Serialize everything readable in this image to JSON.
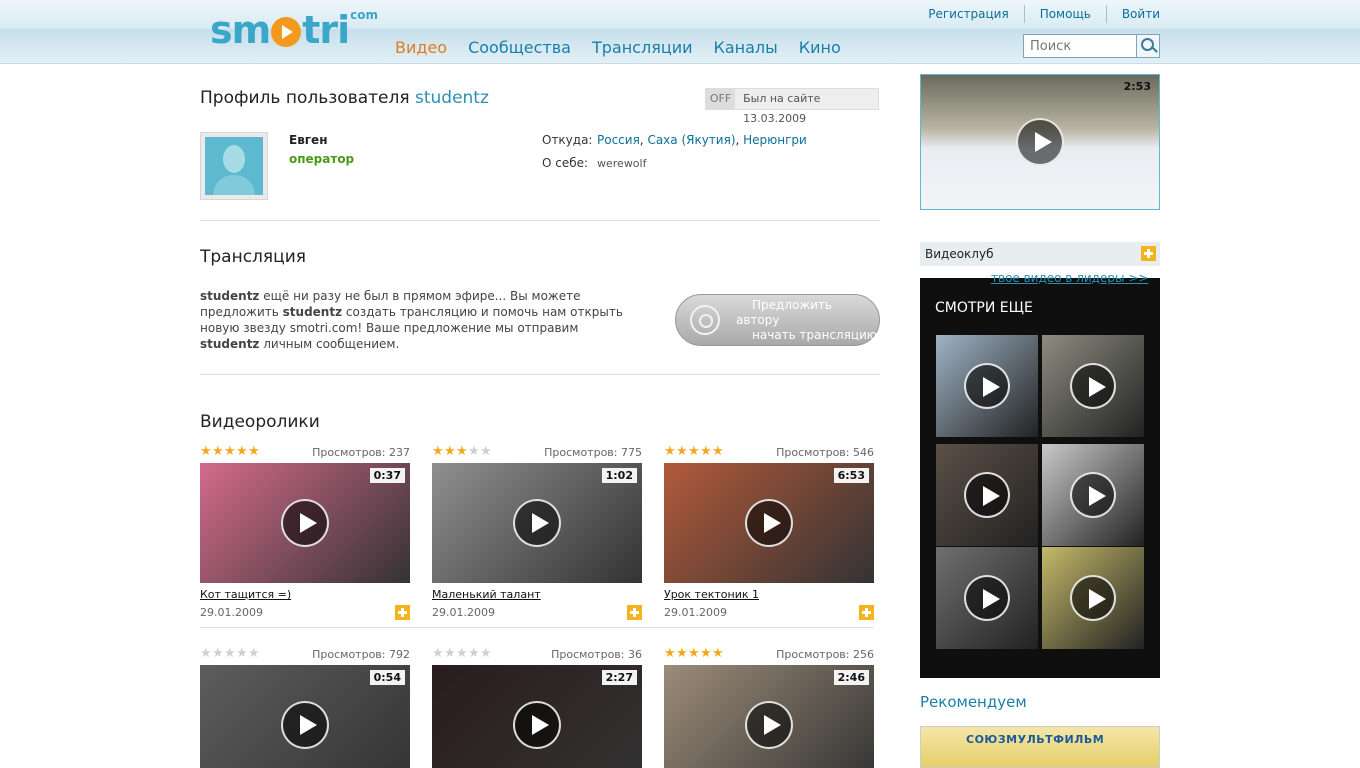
{
  "header": {
    "logo_text_a": "sm",
    "logo_text_b": "tri",
    "logo_com": "com",
    "nav": [
      "Видео",
      "Сообщества",
      "Трансляции",
      "Каналы",
      "Кино"
    ],
    "links": [
      "Регистрация",
      "Помощь",
      "Войти"
    ],
    "search_placeholder": "Поиск"
  },
  "profile": {
    "title_prefix": "Профиль пользователя",
    "username": "studentz",
    "status_off": "OFF",
    "last_seen": "Был на сайте 13.03.2009",
    "name": "Евген",
    "role": "оператор",
    "from_label": "Откуда:",
    "from_places": [
      "Россия",
      "Саха (Якутия)",
      "Нерюнгри"
    ],
    "about_label": "О себе:",
    "about_value": "werewolf"
  },
  "stream": {
    "title": "Трансляция",
    "text_1": "ещё ни разу не был в прямом эфире... Вы можете предложить",
    "text_2": "создать трансляцию и помочь нам открыть новую звезду smotri.com! Ваше предложение мы отправим",
    "text_3": "личным сообщением.",
    "button_line1": "Предложить автору",
    "button_line2": "начать трансляцию"
  },
  "videos": {
    "title": "Видеоролики",
    "items": [
      {
        "title": "Кот тащится =)",
        "date": "29.01.2009",
        "views": "Просмотров: 237",
        "duration": "0:37",
        "rating": 4.5,
        "color": "#d46a8c"
      },
      {
        "title": "Маленький талант",
        "date": "29.01.2009",
        "views": "Просмотров: 775",
        "duration": "1:02",
        "rating": 3,
        "color": "#8f8f8f"
      },
      {
        "title": "Урок тектоник 1",
        "date": "29.01.2009",
        "views": "Просмотров: 546",
        "duration": "6:53",
        "rating": 4.5,
        "color": "#b25a3a"
      },
      {
        "title": "",
        "date": "",
        "views": "Просмотров: 792",
        "duration": "0:54",
        "rating": 0,
        "color": "#5d5d5d"
      },
      {
        "title": "",
        "date": "",
        "views": "Просмотров: 36",
        "duration": "2:27",
        "rating": 0,
        "color": "#2a1c1c"
      },
      {
        "title": "",
        "date": "",
        "views": "Просмотров: 256",
        "duration": "2:46",
        "rating": 5,
        "color": "#9c8c78"
      }
    ]
  },
  "sidebar": {
    "video_duration": "2:53",
    "videoclub": "Видеоклуб",
    "leader_link": "твое видео в лидеры >>",
    "more_title": "СМОТРИ ЕЩЕ",
    "more_colors": [
      "#9fb3c4",
      "#8c8c80",
      "#5b5046",
      "#c9c9c9",
      "#6f6f6f",
      "#c4b96a"
    ],
    "recommend_title": "Рекомендуем",
    "banner_text": "СОЮЗМУЛЬТФИЛЬМ"
  }
}
